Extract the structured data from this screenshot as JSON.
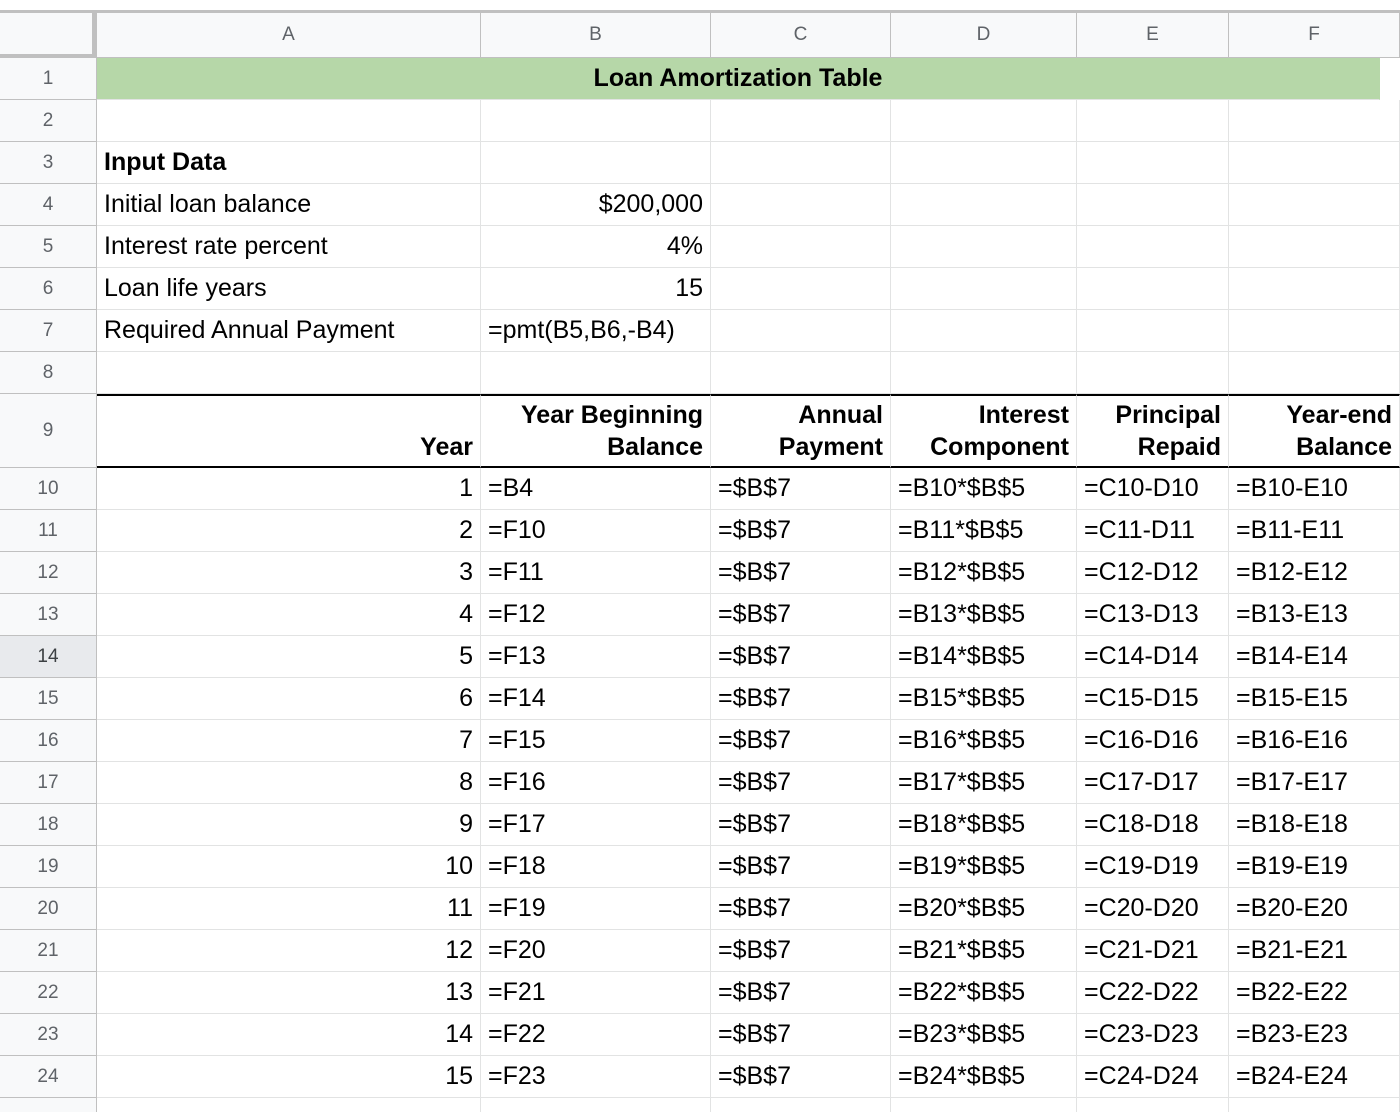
{
  "columns": [
    "A",
    "B",
    "C",
    "D",
    "E",
    "F"
  ],
  "title": "Loan Amortization Table",
  "inputs": {
    "heading": "Input Data",
    "items": [
      {
        "label": "Initial loan balance",
        "value": "$200,000"
      },
      {
        "label": "Interest rate percent",
        "value": "4%"
      },
      {
        "label": "Loan life years",
        "value": "15"
      },
      {
        "label": "Required Annual Payment",
        "value": "=pmt(B5,B6,-B4)"
      }
    ]
  },
  "table_headers": [
    [
      "",
      "Year"
    ],
    [
      "Year Beginning",
      "Balance"
    ],
    [
      "Annual",
      "Payment"
    ],
    [
      "Interest",
      "Component"
    ],
    [
      "Principal",
      "Repaid"
    ],
    [
      "Year-end",
      "Balance"
    ]
  ],
  "amortization_rows": [
    [
      "1",
      "=B4",
      "=$B$7",
      "=B10*$B$5",
      "=C10-D10",
      "=B10-E10"
    ],
    [
      "2",
      "=F10",
      "=$B$7",
      "=B11*$B$5",
      "=C11-D11",
      "=B11-E11"
    ],
    [
      "3",
      "=F11",
      "=$B$7",
      "=B12*$B$5",
      "=C12-D12",
      "=B12-E12"
    ],
    [
      "4",
      "=F12",
      "=$B$7",
      "=B13*$B$5",
      "=C13-D13",
      "=B13-E13"
    ],
    [
      "5",
      "=F13",
      "=$B$7",
      "=B14*$B$5",
      "=C14-D14",
      "=B14-E14"
    ],
    [
      "6",
      "=F14",
      "=$B$7",
      "=B15*$B$5",
      "=C15-D15",
      "=B15-E15"
    ],
    [
      "7",
      "=F15",
      "=$B$7",
      "=B16*$B$5",
      "=C16-D16",
      "=B16-E16"
    ],
    [
      "8",
      "=F16",
      "=$B$7",
      "=B17*$B$5",
      "=C17-D17",
      "=B17-E17"
    ],
    [
      "9",
      "=F17",
      "=$B$7",
      "=B18*$B$5",
      "=C18-D18",
      "=B18-E18"
    ],
    [
      "10",
      "=F18",
      "=$B$7",
      "=B19*$B$5",
      "=C19-D19",
      "=B19-E19"
    ],
    [
      "11",
      "=F19",
      "=$B$7",
      "=B20*$B$5",
      "=C20-D20",
      "=B20-E20"
    ],
    [
      "12",
      "=F20",
      "=$B$7",
      "=B21*$B$5",
      "=C21-D21",
      "=B21-E21"
    ],
    [
      "13",
      "=F21",
      "=$B$7",
      "=B22*$B$5",
      "=C22-D22",
      "=B22-E22"
    ],
    [
      "14",
      "=F22",
      "=$B$7",
      "=B23*$B$5",
      "=C23-D23",
      "=B23-E23"
    ],
    [
      "15",
      "=F23",
      "=$B$7",
      "=B24*$B$5",
      "=C24-D24",
      "=B24-E24"
    ]
  ],
  "row_numbers": [
    "1",
    "2",
    "3",
    "4",
    "5",
    "6",
    "7",
    "8",
    "9",
    "10",
    "11",
    "12",
    "13",
    "14",
    "15",
    "16",
    "17",
    "18",
    "19",
    "20",
    "21",
    "22",
    "23",
    "24"
  ],
  "selected_row": "14",
  "colors": {
    "title_fill": "#b6d7a8",
    "header_fill": "#f8f9fa",
    "grid": "#e2e3e3"
  }
}
